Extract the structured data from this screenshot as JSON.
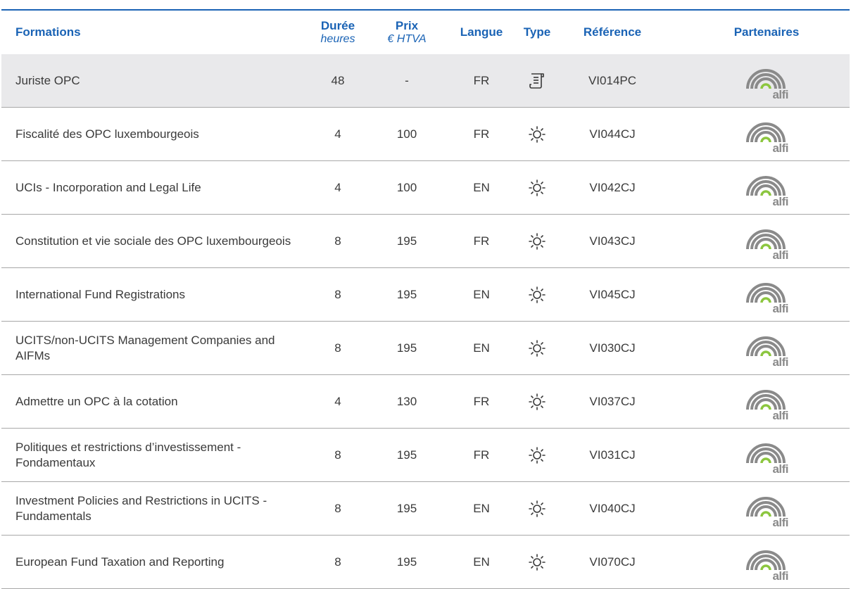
{
  "header": {
    "formations": "Formations",
    "duree": "Durée",
    "duree_unit": "heures",
    "prix": "Prix",
    "prix_unit": "€ HTVA",
    "langue": "Langue",
    "type": "Type",
    "reference": "Référence",
    "partenaires": "Partenaires"
  },
  "colors": {
    "accent_blue": "#1a63b5",
    "highlight_row": "#e9e9eb",
    "logo_grey": "#8a8a8a",
    "logo_green": "#8cc63f"
  },
  "rows": [
    {
      "name": "Juriste OPC",
      "duree": "48",
      "prix": "-",
      "langue": "FR",
      "type_icon": "document-scroll-icon",
      "reference": "VI014PC",
      "partner": "alfi"
    },
    {
      "name": "Fiscalité des OPC luxembourgeois",
      "duree": "4",
      "prix": "100",
      "langue": "FR",
      "type_icon": "sun-icon",
      "reference": "VI044CJ",
      "partner": "alfi"
    },
    {
      "name": "UCIs - Incorporation and Legal Life",
      "duree": "4",
      "prix": "100",
      "langue": "EN",
      "type_icon": "sun-icon",
      "reference": "VI042CJ",
      "partner": "alfi"
    },
    {
      "name": "Constitution et vie sociale des OPC luxembourgeois",
      "duree": "8",
      "prix": "195",
      "langue": "FR",
      "type_icon": "sun-icon",
      "reference": "VI043CJ",
      "partner": "alfi"
    },
    {
      "name": "International Fund Registrations",
      "duree": "8",
      "prix": "195",
      "langue": "EN",
      "type_icon": "sun-icon",
      "reference": "VI045CJ",
      "partner": "alfi"
    },
    {
      "name": "UCITS/non-UCITS Management Companies and AIFMs",
      "duree": "8",
      "prix": "195",
      "langue": "EN",
      "type_icon": "sun-icon",
      "reference": "VI030CJ",
      "partner": "alfi"
    },
    {
      "name": "Admettre un OPC à la cotation",
      "duree": "4",
      "prix": "130",
      "langue": "FR",
      "type_icon": "sun-icon",
      "reference": "VI037CJ",
      "partner": "alfi"
    },
    {
      "name": "Politiques et restrictions d’investissement - Fondamentaux",
      "duree": "8",
      "prix": "195",
      "langue": "FR",
      "type_icon": "sun-icon",
      "reference": "VI031CJ",
      "partner": "alfi"
    },
    {
      "name": "Investment Policies and Restrictions in UCITS - Fundamentals",
      "duree": "8",
      "prix": "195",
      "langue": "EN",
      "type_icon": "sun-icon",
      "reference": "VI040CJ",
      "partner": "alfi"
    },
    {
      "name": "European Fund Taxation and Reporting",
      "duree": "8",
      "prix": "195",
      "langue": "EN",
      "type_icon": "sun-icon",
      "reference": "VI070CJ",
      "partner": "alfi"
    }
  ]
}
